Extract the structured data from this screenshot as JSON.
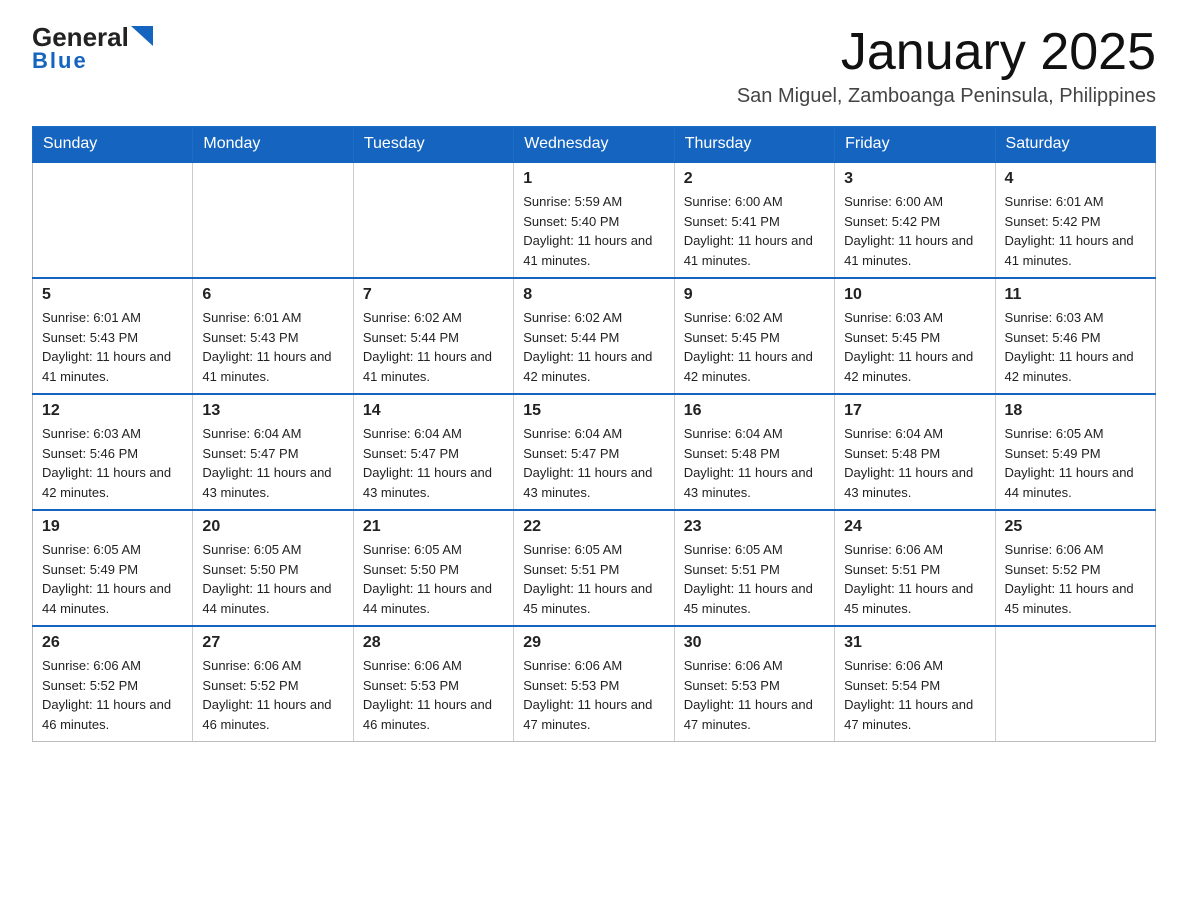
{
  "header": {
    "logo_general": "General",
    "logo_blue": "Blue",
    "month_title": "January 2025",
    "subtitle": "San Miguel, Zamboanga Peninsula, Philippines"
  },
  "days_of_week": [
    "Sunday",
    "Monday",
    "Tuesday",
    "Wednesday",
    "Thursday",
    "Friday",
    "Saturday"
  ],
  "weeks": [
    [
      {
        "day": "",
        "info": ""
      },
      {
        "day": "",
        "info": ""
      },
      {
        "day": "",
        "info": ""
      },
      {
        "day": "1",
        "info": "Sunrise: 5:59 AM\nSunset: 5:40 PM\nDaylight: 11 hours and 41 minutes."
      },
      {
        "day": "2",
        "info": "Sunrise: 6:00 AM\nSunset: 5:41 PM\nDaylight: 11 hours and 41 minutes."
      },
      {
        "day": "3",
        "info": "Sunrise: 6:00 AM\nSunset: 5:42 PM\nDaylight: 11 hours and 41 minutes."
      },
      {
        "day": "4",
        "info": "Sunrise: 6:01 AM\nSunset: 5:42 PM\nDaylight: 11 hours and 41 minutes."
      }
    ],
    [
      {
        "day": "5",
        "info": "Sunrise: 6:01 AM\nSunset: 5:43 PM\nDaylight: 11 hours and 41 minutes."
      },
      {
        "day": "6",
        "info": "Sunrise: 6:01 AM\nSunset: 5:43 PM\nDaylight: 11 hours and 41 minutes."
      },
      {
        "day": "7",
        "info": "Sunrise: 6:02 AM\nSunset: 5:44 PM\nDaylight: 11 hours and 41 minutes."
      },
      {
        "day": "8",
        "info": "Sunrise: 6:02 AM\nSunset: 5:44 PM\nDaylight: 11 hours and 42 minutes."
      },
      {
        "day": "9",
        "info": "Sunrise: 6:02 AM\nSunset: 5:45 PM\nDaylight: 11 hours and 42 minutes."
      },
      {
        "day": "10",
        "info": "Sunrise: 6:03 AM\nSunset: 5:45 PM\nDaylight: 11 hours and 42 minutes."
      },
      {
        "day": "11",
        "info": "Sunrise: 6:03 AM\nSunset: 5:46 PM\nDaylight: 11 hours and 42 minutes."
      }
    ],
    [
      {
        "day": "12",
        "info": "Sunrise: 6:03 AM\nSunset: 5:46 PM\nDaylight: 11 hours and 42 minutes."
      },
      {
        "day": "13",
        "info": "Sunrise: 6:04 AM\nSunset: 5:47 PM\nDaylight: 11 hours and 43 minutes."
      },
      {
        "day": "14",
        "info": "Sunrise: 6:04 AM\nSunset: 5:47 PM\nDaylight: 11 hours and 43 minutes."
      },
      {
        "day": "15",
        "info": "Sunrise: 6:04 AM\nSunset: 5:47 PM\nDaylight: 11 hours and 43 minutes."
      },
      {
        "day": "16",
        "info": "Sunrise: 6:04 AM\nSunset: 5:48 PM\nDaylight: 11 hours and 43 minutes."
      },
      {
        "day": "17",
        "info": "Sunrise: 6:04 AM\nSunset: 5:48 PM\nDaylight: 11 hours and 43 minutes."
      },
      {
        "day": "18",
        "info": "Sunrise: 6:05 AM\nSunset: 5:49 PM\nDaylight: 11 hours and 44 minutes."
      }
    ],
    [
      {
        "day": "19",
        "info": "Sunrise: 6:05 AM\nSunset: 5:49 PM\nDaylight: 11 hours and 44 minutes."
      },
      {
        "day": "20",
        "info": "Sunrise: 6:05 AM\nSunset: 5:50 PM\nDaylight: 11 hours and 44 minutes."
      },
      {
        "day": "21",
        "info": "Sunrise: 6:05 AM\nSunset: 5:50 PM\nDaylight: 11 hours and 44 minutes."
      },
      {
        "day": "22",
        "info": "Sunrise: 6:05 AM\nSunset: 5:51 PM\nDaylight: 11 hours and 45 minutes."
      },
      {
        "day": "23",
        "info": "Sunrise: 6:05 AM\nSunset: 5:51 PM\nDaylight: 11 hours and 45 minutes."
      },
      {
        "day": "24",
        "info": "Sunrise: 6:06 AM\nSunset: 5:51 PM\nDaylight: 11 hours and 45 minutes."
      },
      {
        "day": "25",
        "info": "Sunrise: 6:06 AM\nSunset: 5:52 PM\nDaylight: 11 hours and 45 minutes."
      }
    ],
    [
      {
        "day": "26",
        "info": "Sunrise: 6:06 AM\nSunset: 5:52 PM\nDaylight: 11 hours and 46 minutes."
      },
      {
        "day": "27",
        "info": "Sunrise: 6:06 AM\nSunset: 5:52 PM\nDaylight: 11 hours and 46 minutes."
      },
      {
        "day": "28",
        "info": "Sunrise: 6:06 AM\nSunset: 5:53 PM\nDaylight: 11 hours and 46 minutes."
      },
      {
        "day": "29",
        "info": "Sunrise: 6:06 AM\nSunset: 5:53 PM\nDaylight: 11 hours and 47 minutes."
      },
      {
        "day": "30",
        "info": "Sunrise: 6:06 AM\nSunset: 5:53 PM\nDaylight: 11 hours and 47 minutes."
      },
      {
        "day": "31",
        "info": "Sunrise: 6:06 AM\nSunset: 5:54 PM\nDaylight: 11 hours and 47 minutes."
      },
      {
        "day": "",
        "info": ""
      }
    ]
  ]
}
